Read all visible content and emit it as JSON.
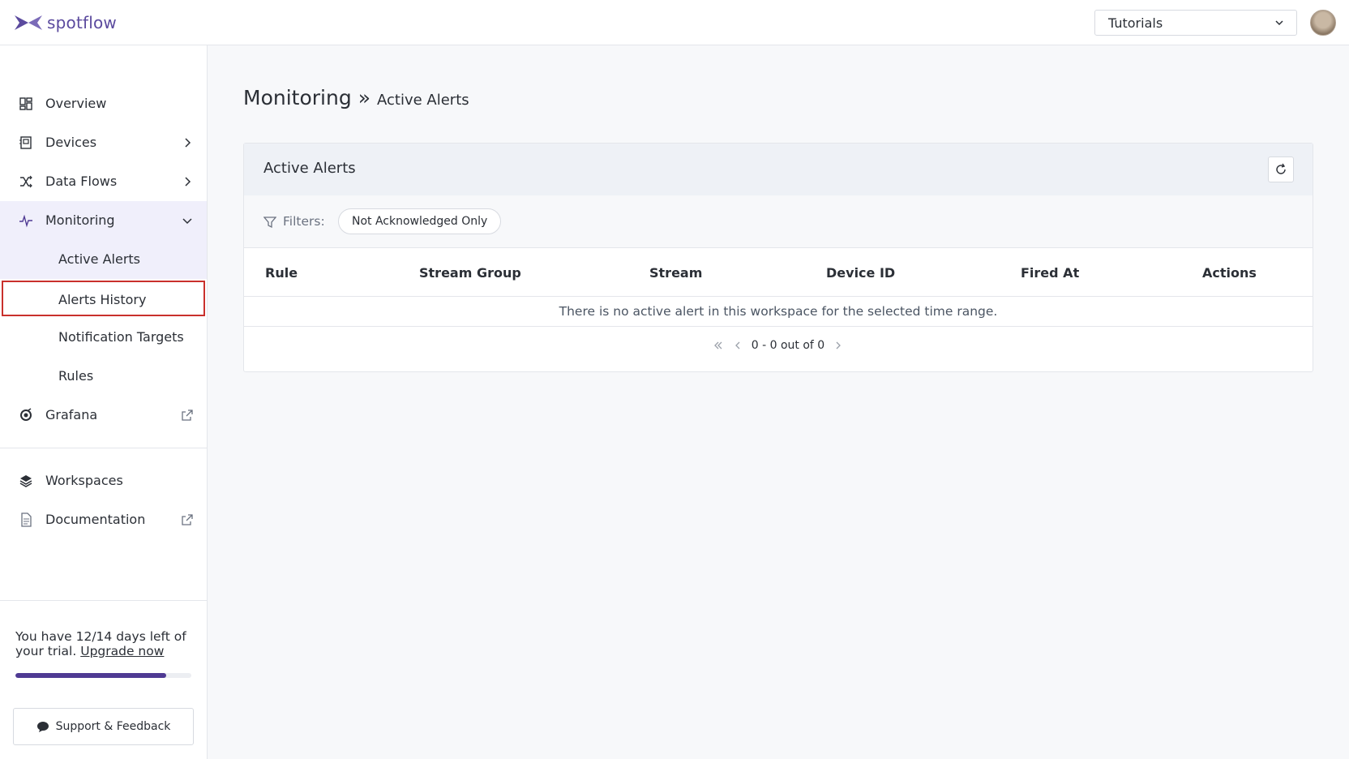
{
  "header": {
    "logo_text": "spotflow",
    "workspace_select": "Tutorials"
  },
  "sidebar": {
    "items": [
      {
        "label": "Overview",
        "icon": "grid-icon"
      },
      {
        "label": "Devices",
        "icon": "device-icon"
      },
      {
        "label": "Data Flows",
        "icon": "shuffle-icon"
      },
      {
        "label": "Monitoring",
        "icon": "pulse-icon"
      },
      {
        "label": "Active Alerts"
      },
      {
        "label": "Alerts History"
      },
      {
        "label": "Notification Targets"
      },
      {
        "label": "Rules"
      },
      {
        "label": "Grafana",
        "icon": "grafana-icon"
      },
      {
        "label": "Workspaces",
        "icon": "layers-icon"
      },
      {
        "label": "Documentation",
        "icon": "document-icon"
      }
    ],
    "trial": {
      "text": "You have 12/14 days left of your trial.",
      "upgrade_label": "Upgrade now",
      "progress_fraction": 0.857
    },
    "support_label": "Support & Feedback"
  },
  "main": {
    "breadcrumb": {
      "main": "Monitoring",
      "separator": "»",
      "sub": "Active Alerts"
    },
    "card": {
      "title": "Active Alerts",
      "filters_label": "Filters:",
      "filter_chip": "Not Acknowledged Only",
      "columns": [
        "Rule",
        "Stream Group",
        "Stream",
        "Device ID",
        "Fired At",
        "Actions"
      ],
      "empty_message": "There is no active alert in this workspace for the selected time range.",
      "pager_text": "0 - 0 out of 0"
    }
  },
  "colors": {
    "accent": "#4f3a93",
    "highlight": "#c9302c",
    "nav_active_bg": "#f0effb"
  }
}
